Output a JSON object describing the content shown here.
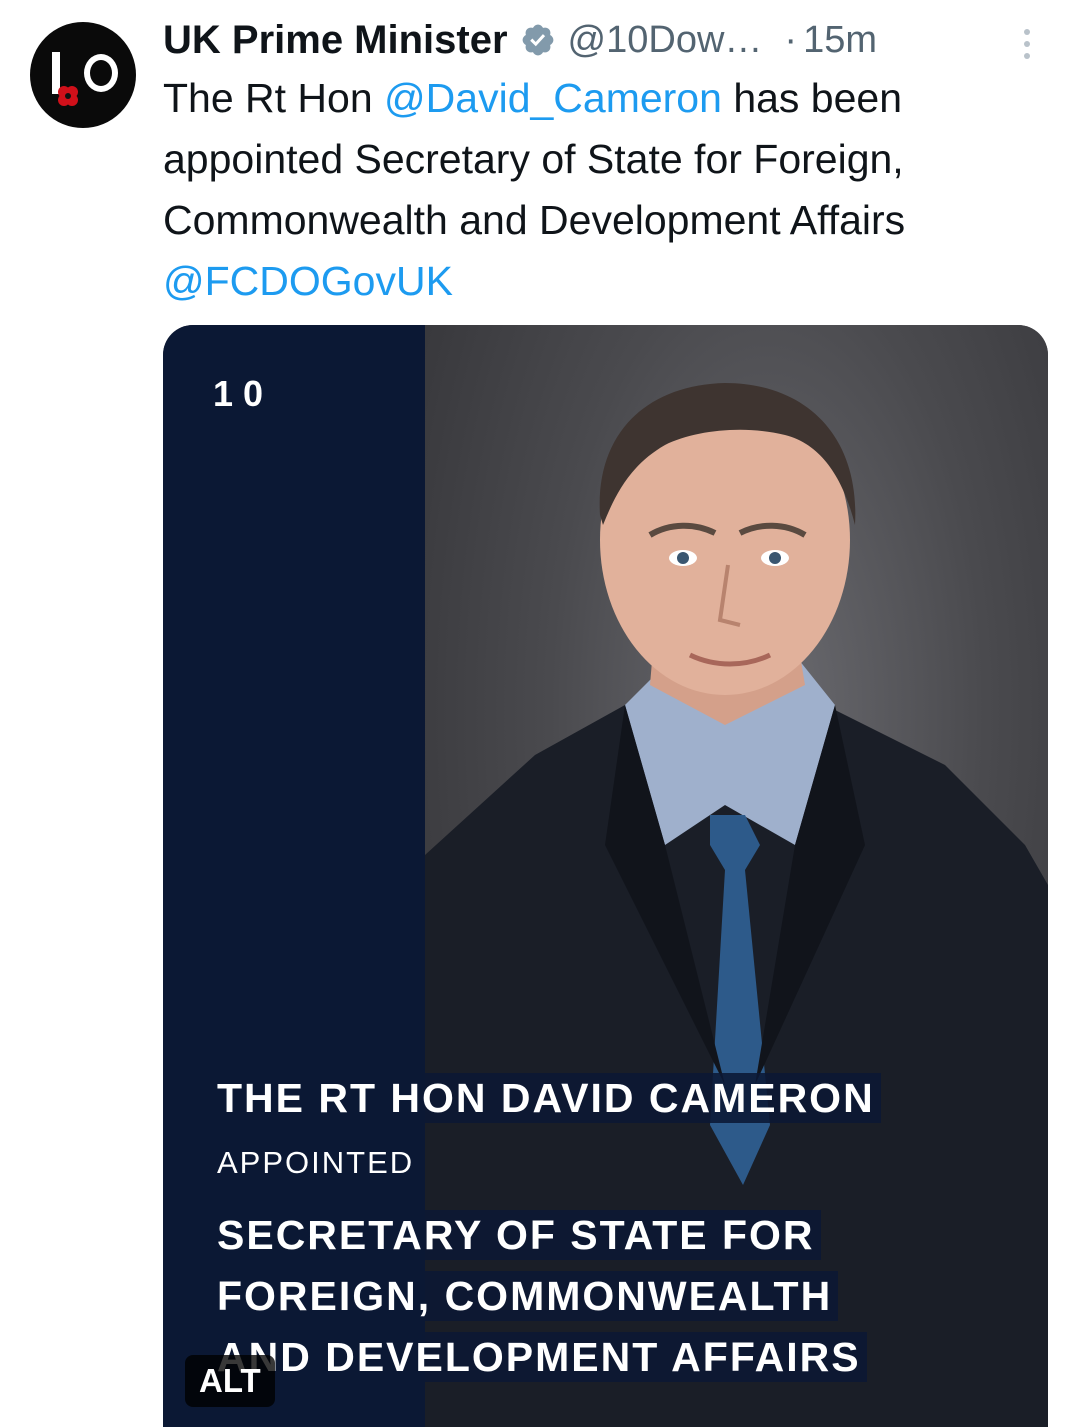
{
  "author": {
    "display_name": "UK Prime Minister",
    "handle": "@10Dow…",
    "verified_badge_icon": "verified-check-icon",
    "timestamp_separator": "·",
    "timestamp": "15m",
    "avatar_icon": "number-ten-logo"
  },
  "tweet": {
    "text_prefix": "The Rt Hon ",
    "mention_1": "@David_Cameron",
    "text_middle": " has been appointed Secretary of State for Foreign, Commonwealth and Development Affairs ",
    "mention_2": "@FCDOGovUK"
  },
  "media": {
    "brand": "10",
    "name_line": "THE RT HON DAVID CAMERON",
    "appointed_label": "APPOINTED",
    "role_line_1": "SECRETARY OF STATE FOR",
    "role_line_2": "FOREIGN, COMMONWEALTH",
    "role_line_3": "AND DEVELOPMENT AFFAIRS",
    "alt_label": "ALT"
  },
  "colors": {
    "link": "#1d9bf0",
    "navy_panel": "#0b1834",
    "text": "#0f1419",
    "secondary": "#536471"
  }
}
